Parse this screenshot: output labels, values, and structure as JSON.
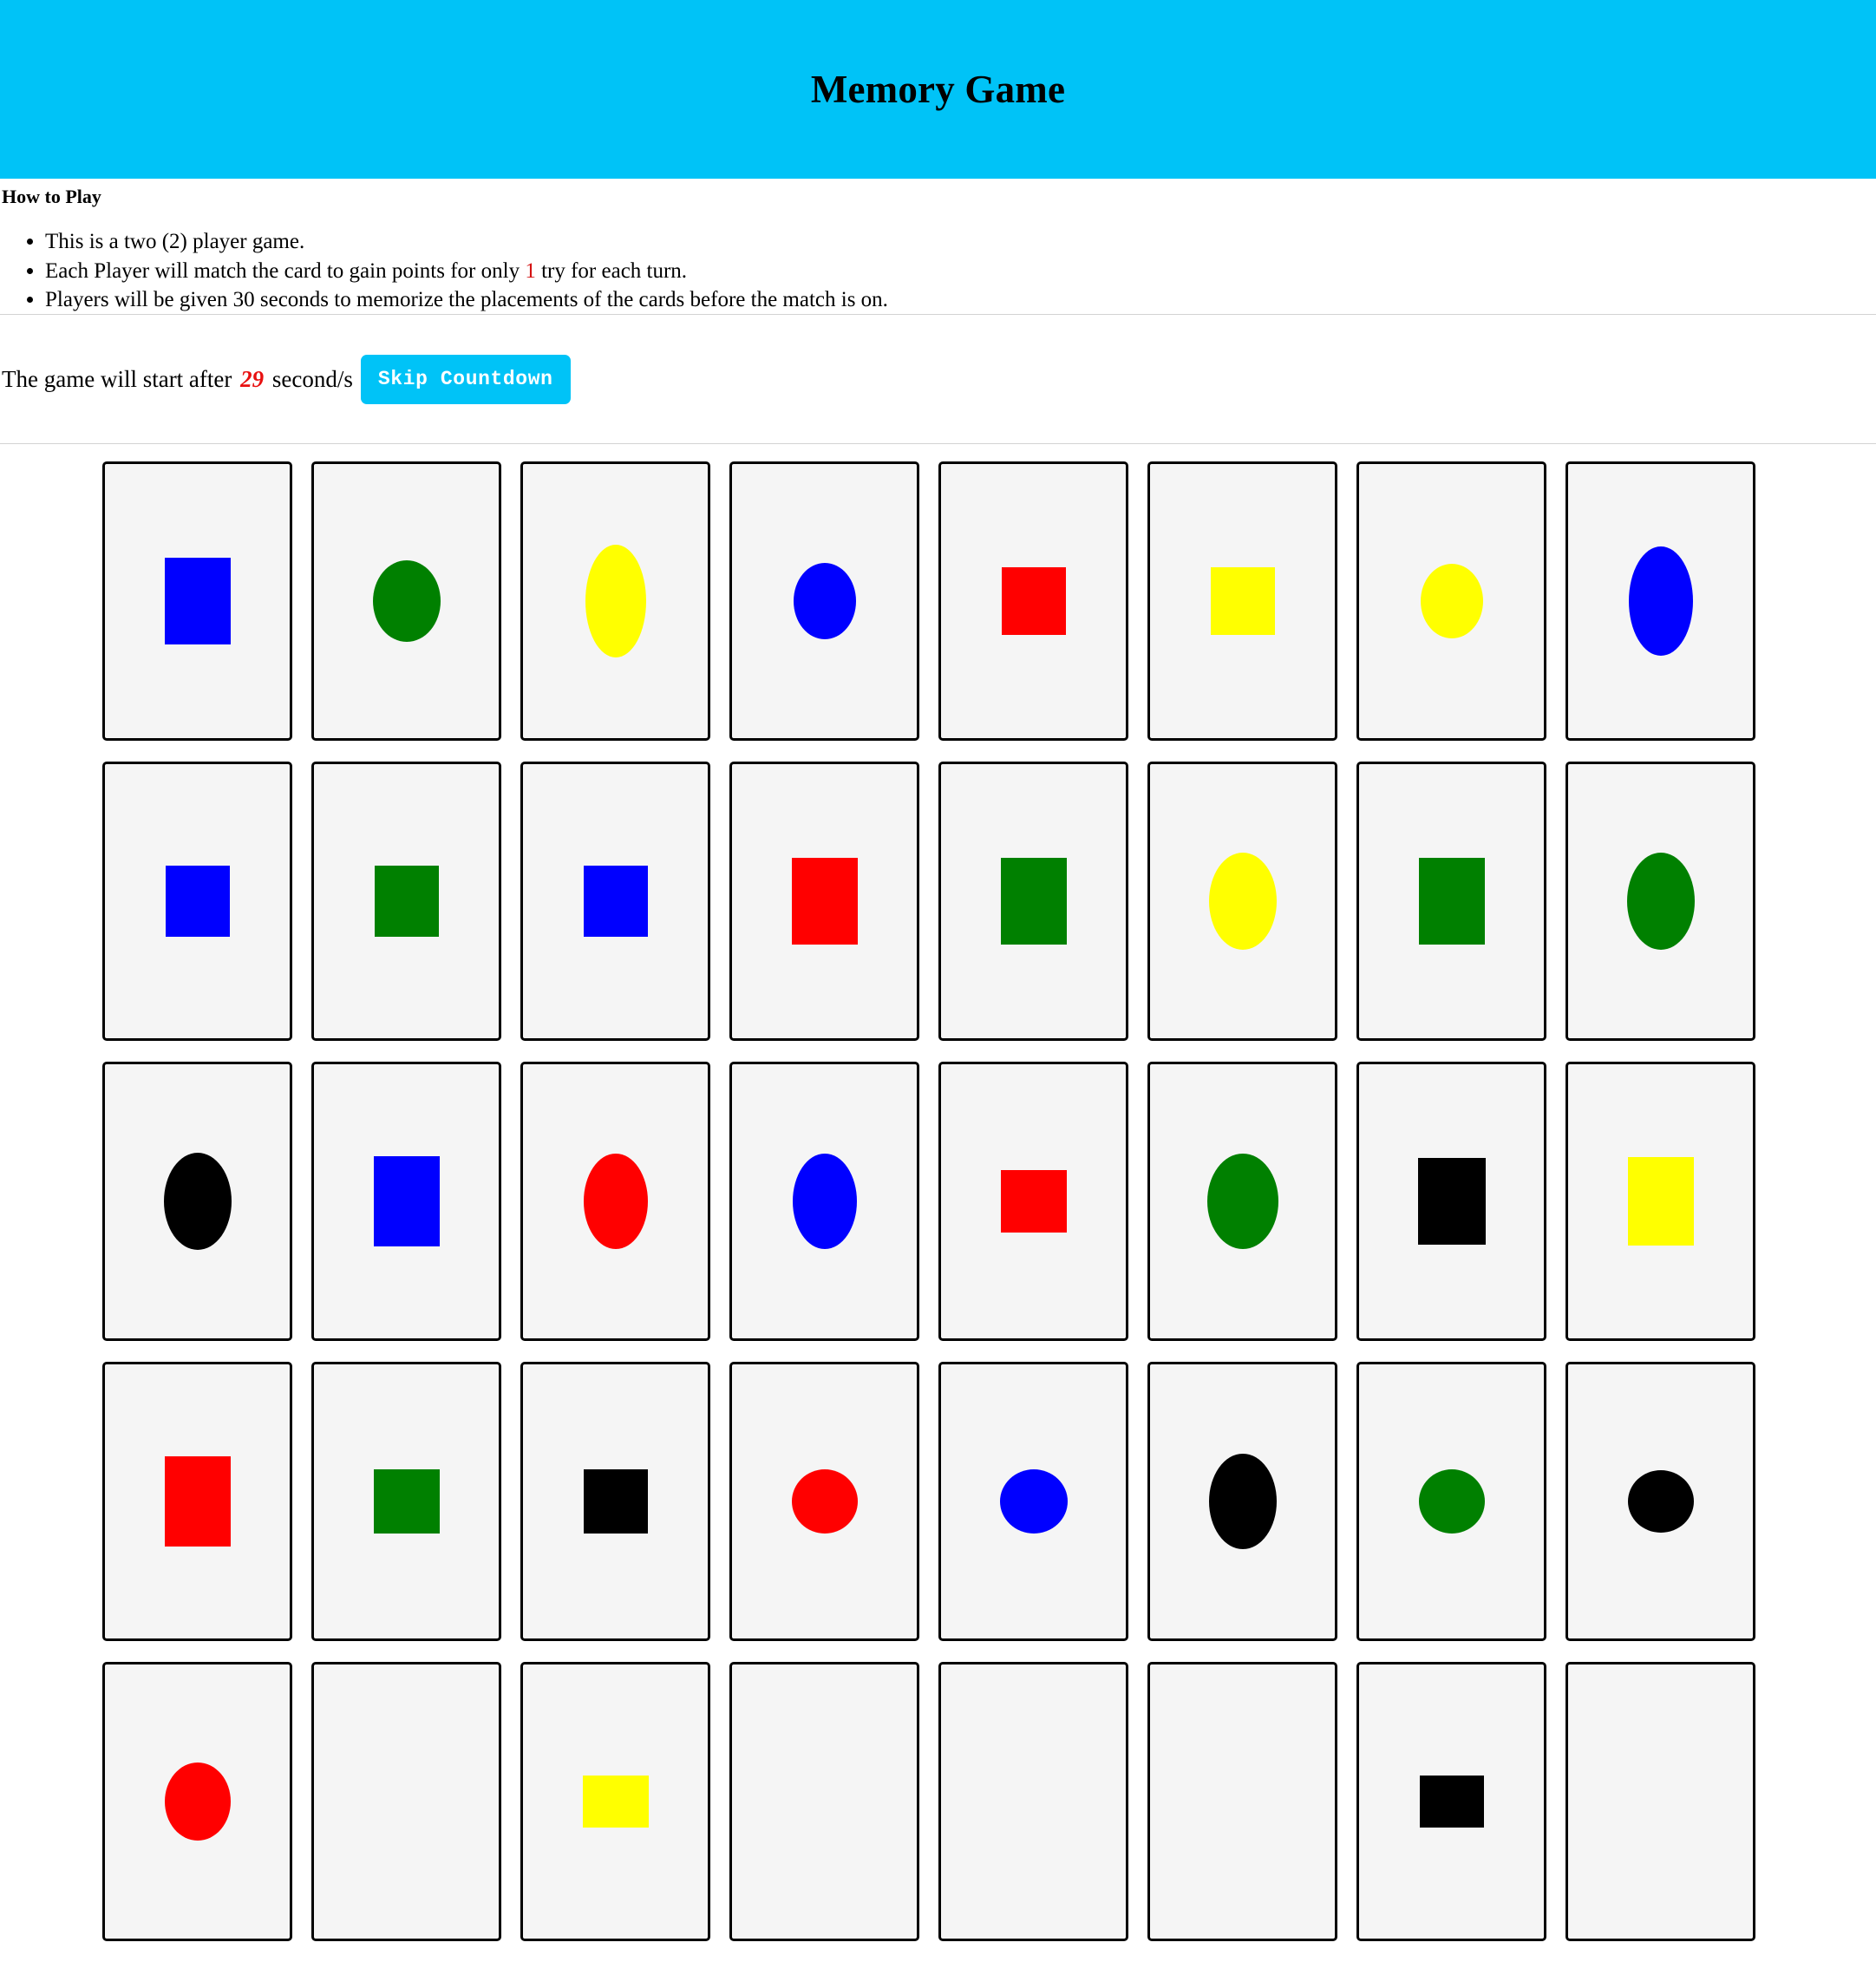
{
  "header": {
    "title": "Memory Game",
    "background_color": "#00c3f7"
  },
  "how_to_play": {
    "heading": "How to Play",
    "rules": [
      {
        "prefix": "This is a two (2) player game.",
        "accent": "",
        "suffix": ""
      },
      {
        "prefix": "Each Player will match the card to gain points for only ",
        "accent": "1",
        "suffix": " try for each turn."
      },
      {
        "prefix": "Players will be given 30 seconds to memorize the placements of the cards before the match is on.",
        "accent": "",
        "suffix": ""
      }
    ]
  },
  "countdown": {
    "prefix": "The game will start after",
    "seconds": "29",
    "suffix": "second/s",
    "skip_label": "Skip Countdown",
    "seconds_color": "#e81010",
    "button_color": "#00c3f7"
  },
  "palette": {
    "blue": "#0000ff",
    "green": "#008000",
    "yellow": "#ffff00",
    "red": "#ff0000",
    "black": "#000000",
    "card_bg": "#f5f5f5",
    "card_border": "#000000"
  },
  "board": {
    "columns": 8,
    "rows": 5,
    "cards": [
      [
        {
          "shape": "rect",
          "color": "#0000ff",
          "w": 76,
          "h": 100,
          "name": "blue-rectangle"
        },
        {
          "shape": "ellipse",
          "color": "#008000",
          "w": 78,
          "h": 94,
          "name": "green-ellipse"
        },
        {
          "shape": "ellipse",
          "color": "#ffff00",
          "w": 70,
          "h": 130,
          "name": "yellow-ellipse"
        },
        {
          "shape": "ellipse",
          "color": "#0000ff",
          "w": 72,
          "h": 88,
          "name": "blue-ellipse"
        },
        {
          "shape": "rect",
          "color": "#ff0000",
          "w": 74,
          "h": 78,
          "name": "red-rectangle"
        },
        {
          "shape": "rect",
          "color": "#ffff00",
          "w": 74,
          "h": 78,
          "name": "yellow-rectangle"
        },
        {
          "shape": "ellipse",
          "color": "#ffff00",
          "w": 72,
          "h": 86,
          "name": "yellow-ellipse"
        },
        {
          "shape": "ellipse",
          "color": "#0000ff",
          "w": 74,
          "h": 126,
          "name": "blue-ellipse"
        }
      ],
      [
        {
          "shape": "rect",
          "color": "#0000ff",
          "w": 74,
          "h": 82,
          "name": "blue-rectangle"
        },
        {
          "shape": "rect",
          "color": "#008000",
          "w": 74,
          "h": 82,
          "name": "green-rectangle"
        },
        {
          "shape": "rect",
          "color": "#0000ff",
          "w": 74,
          "h": 82,
          "name": "blue-rectangle"
        },
        {
          "shape": "rect",
          "color": "#ff0000",
          "w": 76,
          "h": 100,
          "name": "red-rectangle"
        },
        {
          "shape": "rect",
          "color": "#008000",
          "w": 76,
          "h": 100,
          "name": "green-rectangle"
        },
        {
          "shape": "ellipse",
          "color": "#ffff00",
          "w": 78,
          "h": 112,
          "name": "yellow-ellipse"
        },
        {
          "shape": "rect",
          "color": "#008000",
          "w": 76,
          "h": 100,
          "name": "green-rectangle"
        },
        {
          "shape": "ellipse",
          "color": "#008000",
          "w": 78,
          "h": 112,
          "name": "green-ellipse"
        }
      ],
      [
        {
          "shape": "ellipse",
          "color": "#000000",
          "w": 78,
          "h": 112,
          "name": "black-ellipse"
        },
        {
          "shape": "rect",
          "color": "#0000ff",
          "w": 76,
          "h": 104,
          "name": "blue-rectangle"
        },
        {
          "shape": "ellipse",
          "color": "#ff0000",
          "w": 74,
          "h": 110,
          "name": "red-ellipse"
        },
        {
          "shape": "ellipse",
          "color": "#0000ff",
          "w": 74,
          "h": 110,
          "name": "blue-ellipse"
        },
        {
          "shape": "rect",
          "color": "#ff0000",
          "w": 76,
          "h": 72,
          "name": "red-rectangle"
        },
        {
          "shape": "ellipse",
          "color": "#008000",
          "w": 82,
          "h": 110,
          "name": "green-ellipse"
        },
        {
          "shape": "rect",
          "color": "#000000",
          "w": 78,
          "h": 100,
          "name": "black-rectangle"
        },
        {
          "shape": "rect",
          "color": "#ffff00",
          "w": 76,
          "h": 102,
          "name": "yellow-rectangle"
        }
      ],
      [
        {
          "shape": "rect",
          "color": "#ff0000",
          "w": 76,
          "h": 104,
          "name": "red-rectangle"
        },
        {
          "shape": "rect",
          "color": "#008000",
          "w": 76,
          "h": 74,
          "name": "green-rectangle"
        },
        {
          "shape": "rect",
          "color": "#000000",
          "w": 74,
          "h": 74,
          "name": "black-rectangle"
        },
        {
          "shape": "ellipse",
          "color": "#ff0000",
          "w": 76,
          "h": 74,
          "name": "red-ellipse"
        },
        {
          "shape": "ellipse",
          "color": "#0000ff",
          "w": 78,
          "h": 74,
          "name": "blue-ellipse"
        },
        {
          "shape": "ellipse",
          "color": "#000000",
          "w": 78,
          "h": 110,
          "name": "black-ellipse"
        },
        {
          "shape": "ellipse",
          "color": "#008000",
          "w": 76,
          "h": 74,
          "name": "green-ellipse"
        },
        {
          "shape": "ellipse",
          "color": "#000000",
          "w": 76,
          "h": 72,
          "name": "black-ellipse"
        }
      ],
      [
        {
          "shape": "ellipse",
          "color": "#ff0000",
          "w": 76,
          "h": 90,
          "name": "red-ellipse"
        },
        {
          "shape": "none",
          "color": "",
          "w": 0,
          "h": 0,
          "name": "hidden-shape"
        },
        {
          "shape": "rect",
          "color": "#ffff00",
          "w": 76,
          "h": 60,
          "name": "yellow-rectangle"
        },
        {
          "shape": "none",
          "color": "",
          "w": 0,
          "h": 0,
          "name": "hidden-shape"
        },
        {
          "shape": "none",
          "color": "",
          "w": 0,
          "h": 0,
          "name": "hidden-shape"
        },
        {
          "shape": "none",
          "color": "",
          "w": 0,
          "h": 0,
          "name": "hidden-shape"
        },
        {
          "shape": "rect",
          "color": "#000000",
          "w": 74,
          "h": 60,
          "name": "black-rectangle"
        },
        {
          "shape": "none",
          "color": "",
          "w": 0,
          "h": 0,
          "name": "hidden-shape"
        }
      ]
    ]
  }
}
